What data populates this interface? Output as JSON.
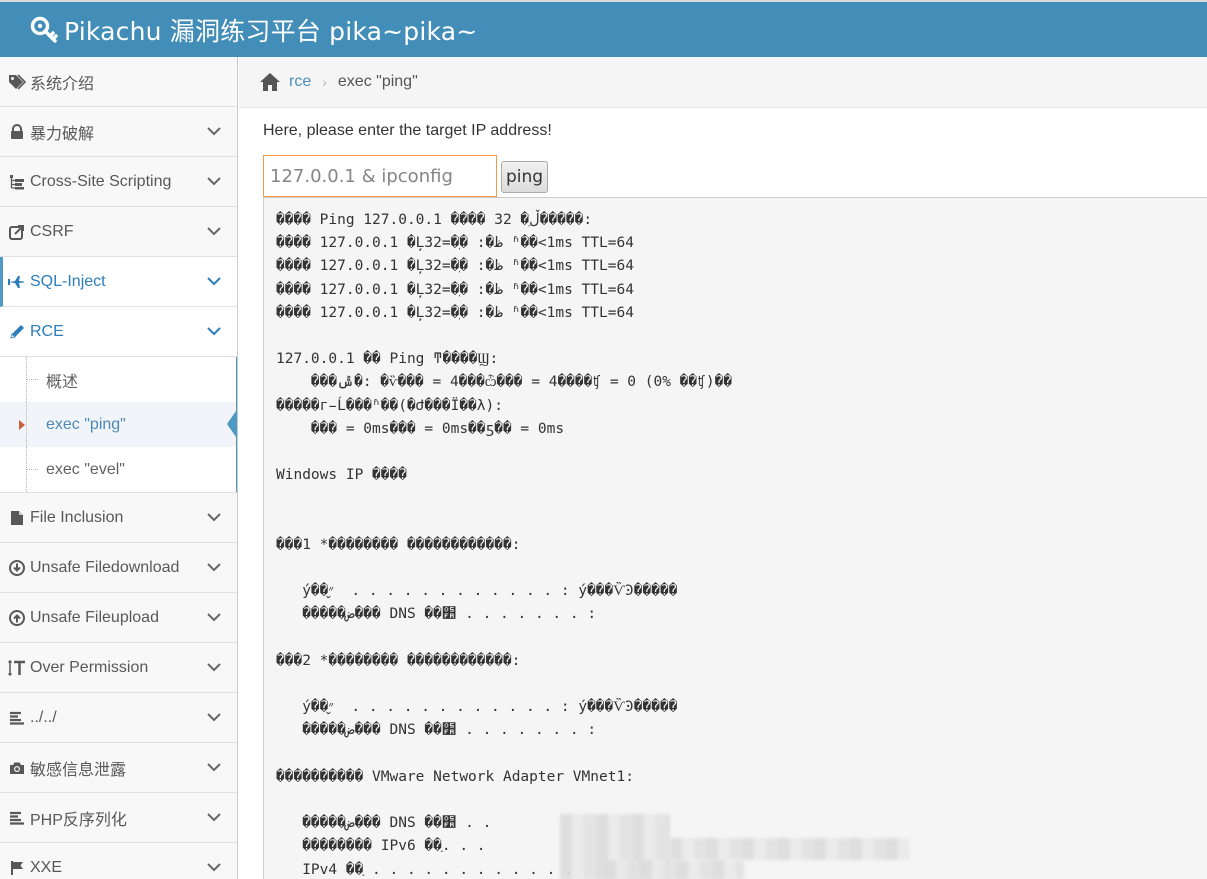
{
  "app": {
    "title": "Pikachu 漏洞练习平台 pika~pika~",
    "logo_icon": "key-icon",
    "brand_color": "#438eb9"
  },
  "sidebar": {
    "items": [
      {
        "label": "系统介绍",
        "icon": "tags-icon"
      },
      {
        "label": "暴力破解",
        "icon": "lock-icon"
      },
      {
        "label": "Cross-Site Scripting",
        "icon": "sitemap-icon"
      },
      {
        "label": "CSRF",
        "icon": "share-icon"
      },
      {
        "label": "SQL-Inject",
        "icon": "plane-icon"
      },
      {
        "label": "RCE",
        "icon": "pencil-icon"
      },
      {
        "label": "File Inclusion",
        "icon": "file-icon"
      },
      {
        "label": "Unsafe Filedownload",
        "icon": "download-icon"
      },
      {
        "label": "Unsafe Fileupload",
        "icon": "upload-icon"
      },
      {
        "label": "Over Permission",
        "icon": "text-height-icon"
      },
      {
        "label": "../../",
        "icon": "align-left-icon"
      },
      {
        "label": "敏感信息泄露",
        "icon": "camera-icon"
      },
      {
        "label": "PHP反序列化",
        "icon": "align-left-icon"
      },
      {
        "label": "XXE",
        "icon": "flag-icon"
      }
    ],
    "rce_submenu": [
      {
        "label": "概述"
      },
      {
        "label": "exec \"ping\""
      },
      {
        "label": "exec \"evel\""
      }
    ]
  },
  "breadcrumb": {
    "home_icon": "home-icon",
    "link": "rce",
    "current": "exec \"ping\""
  },
  "form": {
    "prompt": "Here, please enter the target IP address!",
    "input_value": "127.0.0.1 & ipconfig",
    "button_label": "ping"
  },
  "output": {
    "lines": [
      "���� Ping 127.0.0.1 ���� 32 �ֽڵ�����:",
      "���� 127.0.0.1 �Ļظ�: �ֽ�=32 ʱ��<1ms TTL=64",
      "���� 127.0.0.1 �Ļظ�: �ֽ�=32 ʱ��<1ms TTL=64",
      "���� 127.0.0.1 �Ļظ�: �ֽ�=32 ʱ��<1ms TTL=64",
      "���� 127.0.0.1 �Ļظ�: �ֽ�=32 ʱ��<1ms TTL=64",
      "",
      "127.0.0.1 �� Ping ͳ����Ϣ:",
      "    ���ݰ�: �ѷ��� = 4���ѽ��� = 4����ʧ = 0 (0% ��ʧ)��",
      "�����г̵Ĺ���ʱ��(�Ժ���Ϊ��λ):",
      "    ��� = 0ms��� = 0ms��ƽ�� = 0ms",
      "",
      "Windows IP ����",
      "",
      "",
      "���1 *�������� ������������:",
      "",
      "   ý��״̬  . . . . . . . . . . . . : ý���ѶϿ�����",
      "   �����ض��� DNS ��׺ . . . . . . . :",
      "",
      "���2 *�������� ������������:",
      "",
      "   ý��״̬  . . . . . . . . . . . . : ý���ѶϿ�����",
      "   �����ض��� DNS ��׺ . . . . . . . :",
      "",
      "���������� VMware Network Adapter VMnet1:",
      "",
      "   �����ض��� DNS ��׺ . .",
      "   �������� IPv6 ��ַ. . .",
      "   IPv4 ��ַ . . . . . . . . . . . ."
    ]
  }
}
